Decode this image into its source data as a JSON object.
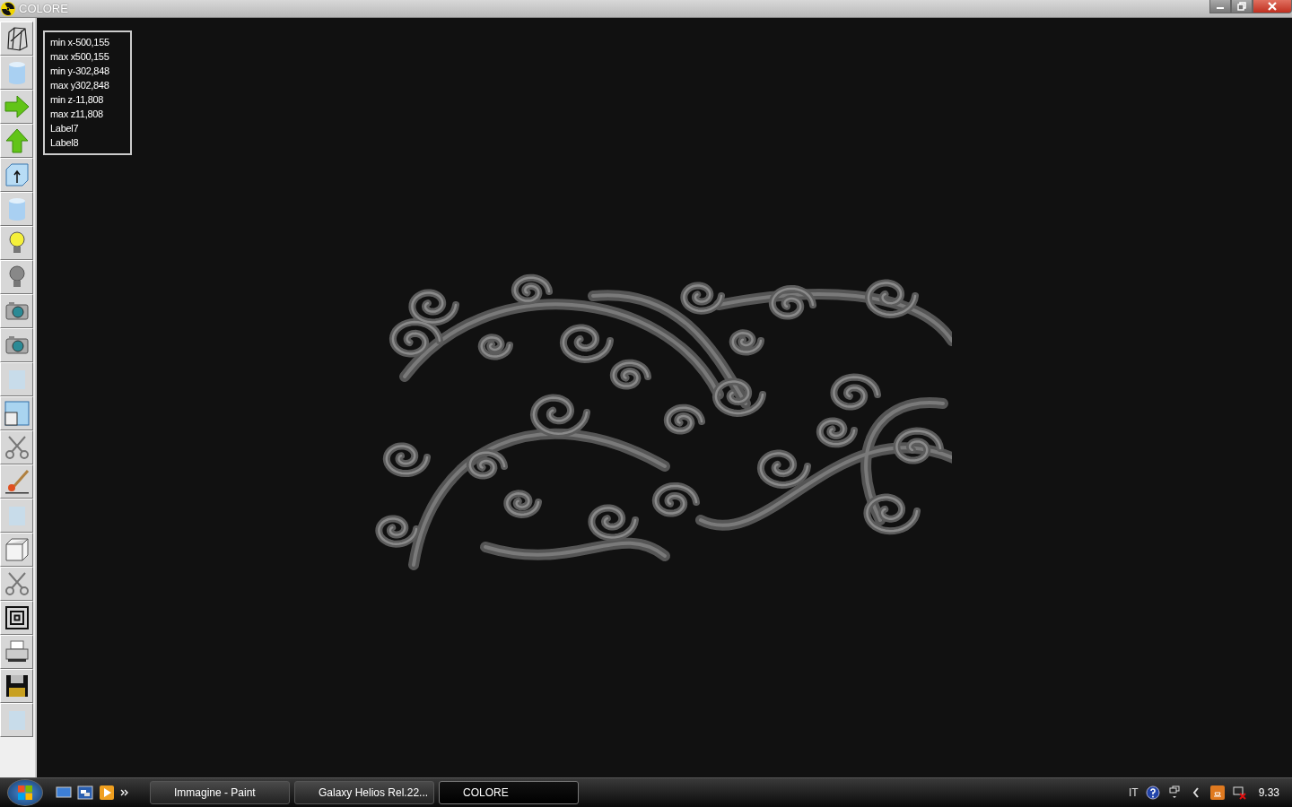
{
  "window": {
    "title": "COLORE"
  },
  "toolbar": [
    {
      "kind": "wireframe"
    },
    {
      "kind": "cylinder"
    },
    {
      "kind": "arrow-right"
    },
    {
      "kind": "arrow-up"
    },
    {
      "kind": "box-arrow"
    },
    {
      "kind": "cylinder"
    },
    {
      "kind": "bulb-on"
    },
    {
      "kind": "bulb-off"
    },
    {
      "kind": "camera"
    },
    {
      "kind": "camera"
    },
    {
      "kind": "faded"
    },
    {
      "kind": "window"
    },
    {
      "kind": "scissors"
    },
    {
      "kind": "brush"
    },
    {
      "kind": "faded"
    },
    {
      "kind": "cube"
    },
    {
      "kind": "scissors"
    },
    {
      "kind": "squares"
    },
    {
      "kind": "printer"
    },
    {
      "kind": "floppy"
    },
    {
      "kind": "faded"
    }
  ],
  "info_panel": [
    "min x-500,155",
    "max x500,155",
    "min y-302,848",
    "max y302,848",
    "min z-11,808",
    "max z11,808",
    "Label7",
    "Label8"
  ],
  "taskbar": {
    "items": [
      {
        "label": "Immagine - Paint",
        "selected": false
      },
      {
        "label": "Galaxy Helios  Rel.22...",
        "selected": false
      },
      {
        "label": "COLORE",
        "selected": true
      }
    ],
    "tray": {
      "language": "IT",
      "clock": "9.33"
    }
  }
}
